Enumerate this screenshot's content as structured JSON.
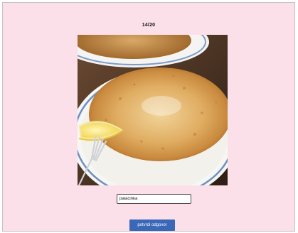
{
  "quiz": {
    "counter": "14/20",
    "answer_value": "palačinka",
    "submit_label": "potvrdi odgovor"
  },
  "colors": {
    "background": "#fbe0ea",
    "button": "#3a67b8"
  }
}
